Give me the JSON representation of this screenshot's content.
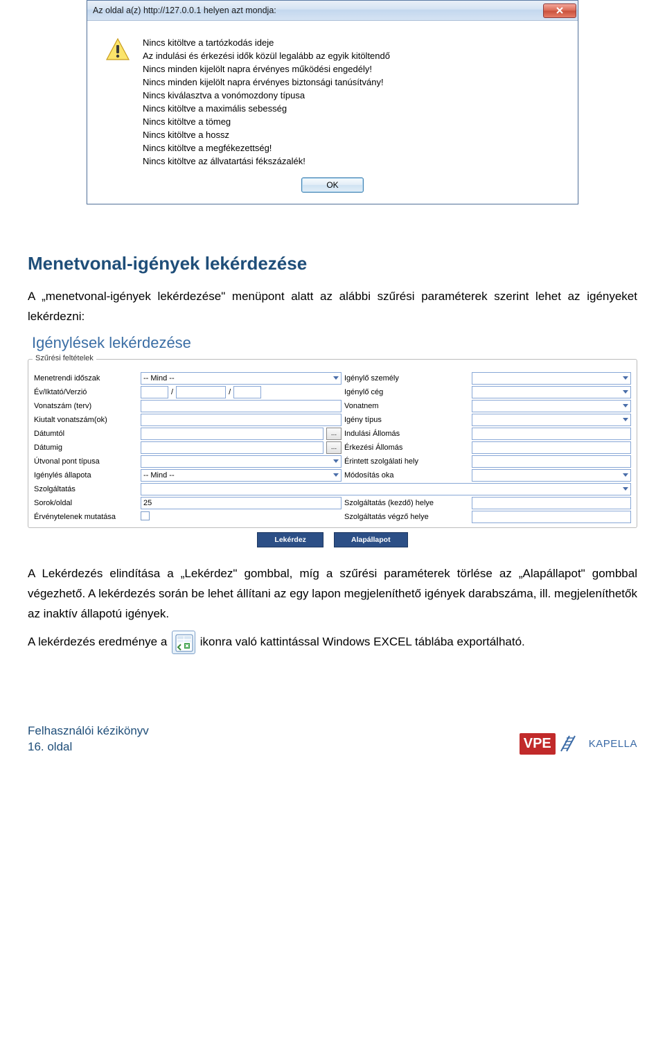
{
  "dialog": {
    "title": "Az oldal a(z) http://127.0.0.1 helyen azt mondja:",
    "lines": [
      "Nincs kitöltve a tartózkodás ideje",
      "Az indulási és érkezési idők közül legalább az egyik kitöltendő",
      "Nincs minden kijelölt napra érvényes működési engedély!",
      "Nincs minden kijelölt napra érvényes biztonsági tanúsítvány!",
      "Nincs kiválasztva a vonómozdony típusa",
      "Nincs kitöltve a maximális sebesség",
      "Nincs kitöltve a tömeg",
      "Nincs kitöltve a hossz",
      "Nincs kitöltve a megfékezettség!",
      "Nincs kitöltve az állvatartási fékszázalék!"
    ],
    "ok": "OK"
  },
  "heading": "Menetvonal-igények lekérdezése",
  "para1": "A „menetvonal-igények lekérdezése\" menüpont alatt az alábbi szűrési paraméterek szerint lehet az igényeket lekérdezni:",
  "form": {
    "title": "Igénylések lekérdezése",
    "legend": "Szűrési feltételek",
    "labels": {
      "menetrendi": "Menetrendi időszak",
      "ev": "Év/Iktató/Verzió",
      "vonatszam": "Vonatszám (terv)",
      "kiutalt": "Kiutalt vonatszám(ok)",
      "datumtol": "Dátumtól",
      "datumig": "Dátumig",
      "utvonal": "Útvonal pont típusa",
      "igenyles_allapota": "Igénylés állapota",
      "szolgaltatas": "Szolgáltatás",
      "sorok": "Sorok/oldal",
      "ervenytelenek": "Érvénytelenek mutatása",
      "igenylo_szemely": "Igénylő személy",
      "igenylo_ceg": "Igénylő cég",
      "vonatnem": "Vonatnem",
      "igeny_tipus": "Igény típus",
      "indulasi": "Indulási Állomás",
      "erkezesi": "Érkezési Állomás",
      "erintett": "Érintett szolgálati hely",
      "modositas": "Módosítás oka",
      "szolg_kezdo": "Szolgáltatás (kezdő) helye",
      "szolg_vegzo": "Szolgáltatás végző helye"
    },
    "mind": "-- Mind --",
    "slash": "/",
    "sorok_value": "25",
    "dots": "...",
    "btn_lekerdez": "Lekérdez",
    "btn_alap": "Alapállapot"
  },
  "para2": "A Lekérdezés elindítása a „Lekérdez\" gombbal, míg a szűrési paraméterek törlése az „Alapállapot\" gombbal végezhető. A lekérdezés során be lehet állítani az egy lapon megjeleníthető igények darabszáma, ill. megjeleníthetők az inaktív állapotú igények.",
  "para3_a": "A lekérdezés eredménye a ",
  "para3_b": " ikonra való kattintással Windows EXCEL táblába exportálható.",
  "footer": {
    "line1": "Felhasználói kézikönyv",
    "line2": "16. oldal",
    "vpe": "VPE",
    "kapella": "KAPELLA"
  }
}
